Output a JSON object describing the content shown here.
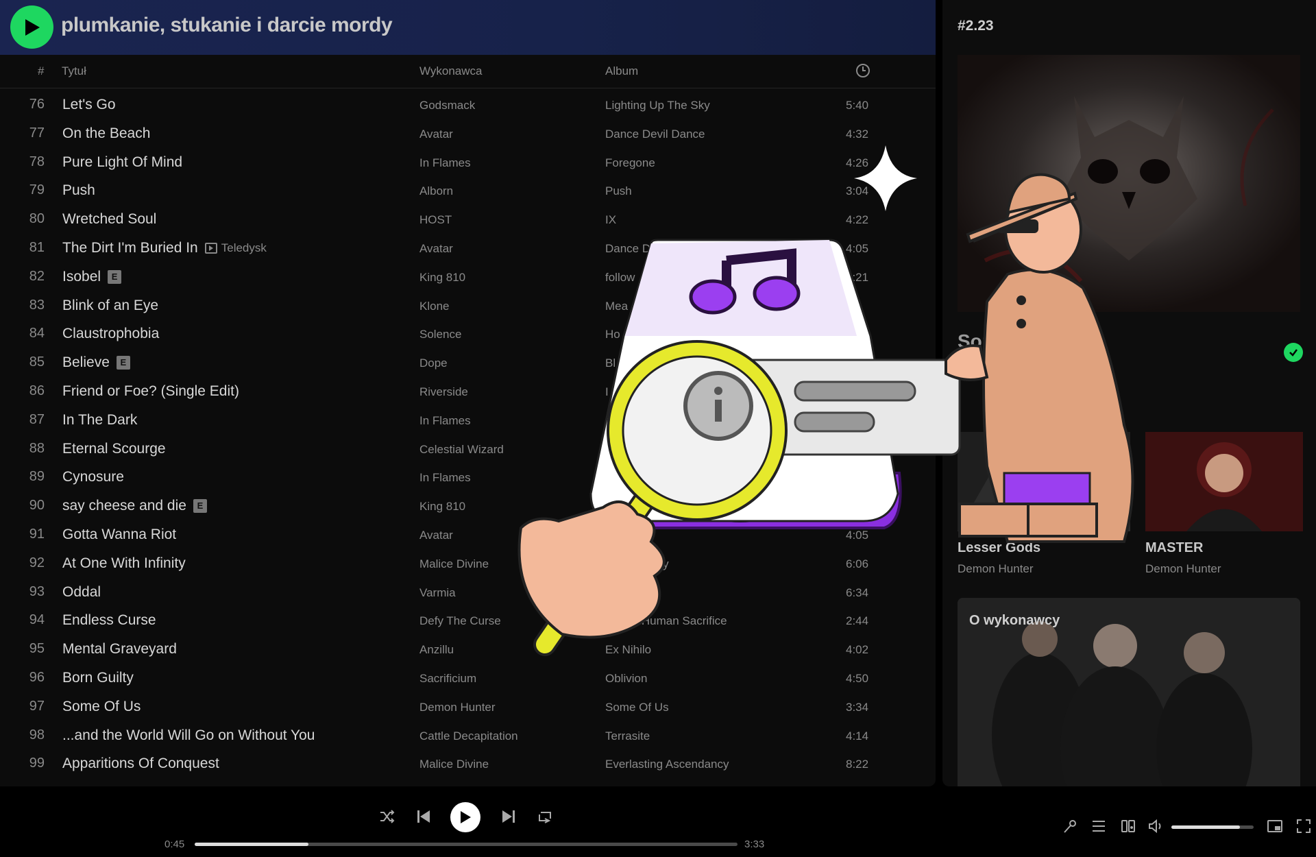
{
  "playlist": {
    "title": "plumkanie, stukanie i darcie mordy",
    "columns": {
      "num": "#",
      "title": "Tytuł",
      "artist": "Wykonawca",
      "album": "Album"
    },
    "tracks": [
      {
        "num": "76",
        "title": "Let's Go",
        "artist": "Godsmack",
        "album": "Lighting Up The Sky",
        "duration": "5:40"
      },
      {
        "num": "77",
        "title": "On the Beach",
        "artist": "Avatar",
        "album": "Dance Devil Dance",
        "duration": "4:32"
      },
      {
        "num": "78",
        "title": "Pure Light Of Mind",
        "artist": "In Flames",
        "album": "Foregone",
        "duration": "4:26"
      },
      {
        "num": "79",
        "title": "Push",
        "artist": "Alborn",
        "album": "Push",
        "duration": "3:04"
      },
      {
        "num": "80",
        "title": "Wretched Soul",
        "artist": "HOST",
        "album": "IX",
        "duration": "4:22"
      },
      {
        "num": "81",
        "title": "The Dirt I'm Buried In",
        "tag": "Teledysk",
        "artist": "Avatar",
        "album": "Dance D",
        "duration": "4:05"
      },
      {
        "num": "82",
        "title": "Isobel",
        "explicit": "E",
        "artist": "King 810",
        "album": "follow",
        "duration": "4:21"
      },
      {
        "num": "83",
        "title": "Blink of an Eye",
        "artist": "Klone",
        "album": "Mea",
        "duration": "22"
      },
      {
        "num": "84",
        "title": "Claustrophobia",
        "artist": "Solence",
        "album": "Ho",
        "duration": "4"
      },
      {
        "num": "85",
        "title": "Believe",
        "explicit": "E",
        "artist": "Dope",
        "album": "Bl",
        "duration": ""
      },
      {
        "num": "86",
        "title": "Friend or Foe? (Single Edit)",
        "artist": "Riverside",
        "album": "I",
        "duration": ""
      },
      {
        "num": "87",
        "title": "In The Dark",
        "artist": "In Flames",
        "album": "",
        "duration": ""
      },
      {
        "num": "88",
        "title": "Eternal Scourge",
        "artist": "Celestial Wizard",
        "album": "",
        "duration": ""
      },
      {
        "num": "89",
        "title": "Cynosure",
        "artist": "In Flames",
        "album": "",
        "duration": ""
      },
      {
        "num": "90",
        "title": "say cheese and die",
        "explicit": "E",
        "artist": "King 810",
        "album": "",
        "duration": ""
      },
      {
        "num": "91",
        "title": "Gotta Wanna Riot",
        "artist": "Avatar",
        "album": "l Dance",
        "duration": "4:05"
      },
      {
        "num": "92",
        "title": "At One With Infinity",
        "artist": "Malice Divine",
        "album": "Ascendancy",
        "duration": "6:06"
      },
      {
        "num": "93",
        "title": "Oddal",
        "artist": "Varmia",
        "album": "",
        "duration": "6:34"
      },
      {
        "num": "94",
        "title": "Endless Curse",
        "artist": "Defy The Curse",
        "album": "rors of Human Sacrifice",
        "duration": "2:44"
      },
      {
        "num": "95",
        "title": "Mental Graveyard",
        "artist": "Anzillu",
        "album": "Ex Nihilo",
        "duration": "4:02"
      },
      {
        "num": "96",
        "title": "Born Guilty",
        "artist": "Sacrificium",
        "album": "Oblivion",
        "duration": "4:50"
      },
      {
        "num": "97",
        "title": "Some Of Us",
        "artist": "Demon Hunter",
        "album": "Some Of Us",
        "duration": "3:34"
      },
      {
        "num": "98",
        "title": "...and the World Will Go on Without You",
        "artist": "Cattle Decapitation",
        "album": "Terrasite",
        "duration": "4:14"
      },
      {
        "num": "99",
        "title": "Apparitions Of Conquest",
        "artist": "Malice Divine",
        "album": "Everlasting Ascendancy",
        "duration": "8:22"
      }
    ]
  },
  "now_playing_panel": {
    "title": "#2.23",
    "song_title": "Som",
    "cards": [
      {
        "label": "Lesser Gods",
        "sub": "Demon Hunter"
      },
      {
        "label": "MASTER",
        "sub": "Demon Hunter"
      }
    ],
    "about_label": "O wykonawcy"
  },
  "player": {
    "elapsed": "0:45",
    "total": "3:33",
    "progress": 0.21,
    "volume": 0.83
  },
  "colors": {
    "accent": "#1ed760",
    "header_bg": "#1a2450"
  },
  "icons": [
    "play-icon",
    "shuffle-icon",
    "previous-icon",
    "next-icon",
    "repeat-icon",
    "clock-icon",
    "lyrics-icon",
    "queue-icon",
    "connect-device-icon",
    "volume-icon",
    "miniplayer-icon",
    "fullscreen-icon",
    "check-icon"
  ]
}
